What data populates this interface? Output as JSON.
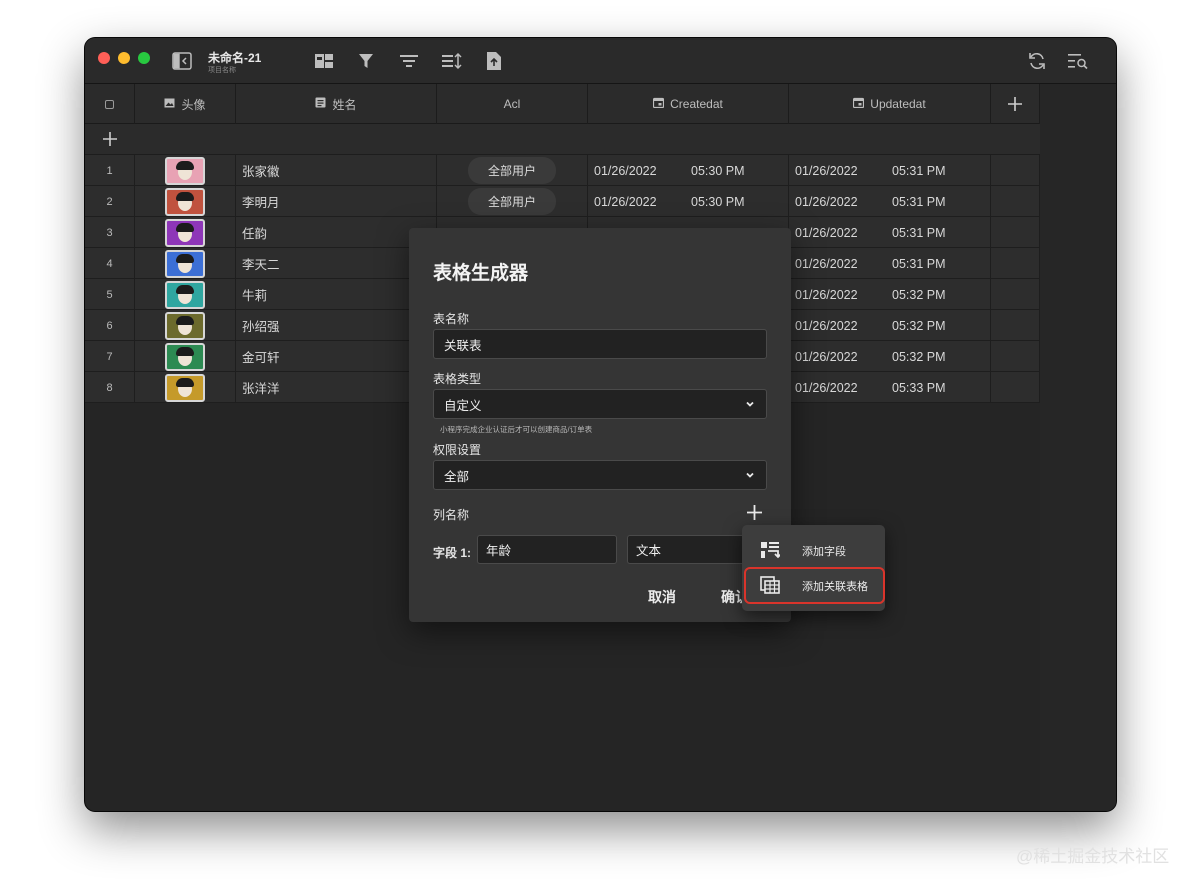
{
  "window": {
    "title": "未命名-21",
    "subtitle": "项目名称"
  },
  "table": {
    "columns": [
      "头像",
      "姓名",
      "Acl",
      "Createdat",
      "Updatedat"
    ],
    "rows": [
      {
        "num": "1",
        "name": "张家徽",
        "acl": "全部用户",
        "created_date": "01/26/2022",
        "created_time": "05:30 PM",
        "updated_date": "01/26/2022",
        "updated_time": "05:31 PM",
        "avatar_color": "#e8a2b4"
      },
      {
        "num": "2",
        "name": "李明月",
        "acl": "全部用户",
        "created_date": "01/26/2022",
        "created_time": "05:30 PM",
        "updated_date": "01/26/2022",
        "updated_time": "05:31 PM",
        "avatar_color": "#c0523e"
      },
      {
        "num": "3",
        "name": "任韵",
        "acl": "",
        "created_date": "",
        "created_time": "",
        "updated_date": "01/26/2022",
        "updated_time": "05:31 PM",
        "avatar_color": "#8e36b8"
      },
      {
        "num": "4",
        "name": "李天二",
        "acl": "",
        "created_date": "",
        "created_time": "",
        "updated_date": "01/26/2022",
        "updated_time": "05:31 PM",
        "avatar_color": "#3c6fd6"
      },
      {
        "num": "5",
        "name": "牛莉",
        "acl": "",
        "created_date": "",
        "created_time": "",
        "updated_date": "01/26/2022",
        "updated_time": "05:32 PM",
        "avatar_color": "#2fa6a0"
      },
      {
        "num": "6",
        "name": "孙绍强",
        "acl": "",
        "created_date": "",
        "created_time": "",
        "updated_date": "01/26/2022",
        "updated_time": "05:32 PM",
        "avatar_color": "#6c6a2c"
      },
      {
        "num": "7",
        "name": "金可轩",
        "acl": "",
        "created_date": "",
        "created_time": "",
        "updated_date": "01/26/2022",
        "updated_time": "05:32 PM",
        "avatar_color": "#2c8a52"
      },
      {
        "num": "8",
        "name": "张洋洋",
        "acl": "",
        "created_date": "",
        "created_time": "",
        "updated_date": "01/26/2022",
        "updated_time": "05:33 PM",
        "avatar_color": "#c59a2a"
      }
    ]
  },
  "modal": {
    "title": "表格生成器",
    "table_name_label": "表名称",
    "table_name_value": "关联表",
    "table_type_label": "表格类型",
    "table_type_value": "自定义",
    "table_type_hint": "小程序完成企业认证后才可以创建商品/订单表",
    "permission_label": "权限设置",
    "permission_value": "全部",
    "columns_label": "列名称",
    "field1_label": "字段 1:",
    "field1_name": "年龄",
    "field1_type": "文本",
    "cancel_label": "取消",
    "confirm_label": "确认"
  },
  "popup_menu": {
    "items": [
      "添加字段",
      "添加关联表格"
    ],
    "highlight_color": "#d9342b"
  },
  "watermark": "@稀土掘金技术社区"
}
